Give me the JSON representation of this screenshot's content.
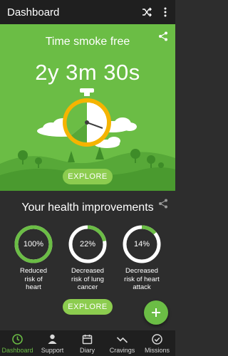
{
  "appbar": {
    "title": "Dashboard",
    "icons": [
      "shuffle-icon",
      "more-vert-icon"
    ]
  },
  "hero": {
    "title": "Time smoke free",
    "timer": "2y 3m 30s",
    "button": "EXPLORE"
  },
  "health": {
    "title": "Your health improvements",
    "items": [
      {
        "percent_label": "100%",
        "percent": 100,
        "caption": [
          "Reduced",
          "risk of",
          "heart"
        ]
      },
      {
        "percent_label": "22%",
        "percent": 22,
        "caption": [
          "Decreased",
          "risk of lung",
          "cancer"
        ]
      },
      {
        "percent_label": "14%",
        "percent": 14,
        "caption": [
          "Decreased",
          "risk of heart",
          "attack"
        ]
      }
    ],
    "button": "EXPLORE"
  },
  "fab": {
    "icon": "plus-icon"
  },
  "nav": {
    "items": [
      {
        "label": "Dashboard",
        "icon": "clock-icon",
        "active": true
      },
      {
        "label": "Support",
        "icon": "person-icon",
        "active": false
      },
      {
        "label": "Diary",
        "icon": "calendar-icon",
        "active": false
      },
      {
        "label": "Cravings",
        "icon": "trend-icon",
        "active": false
      },
      {
        "label": "Missions",
        "icon": "check-circle-icon",
        "active": false
      }
    ]
  },
  "colors": {
    "accent": "#6bbd45",
    "accent_light": "#8ccc4f",
    "background": "#2d2d2d",
    "bar": "#1f1f1f"
  }
}
